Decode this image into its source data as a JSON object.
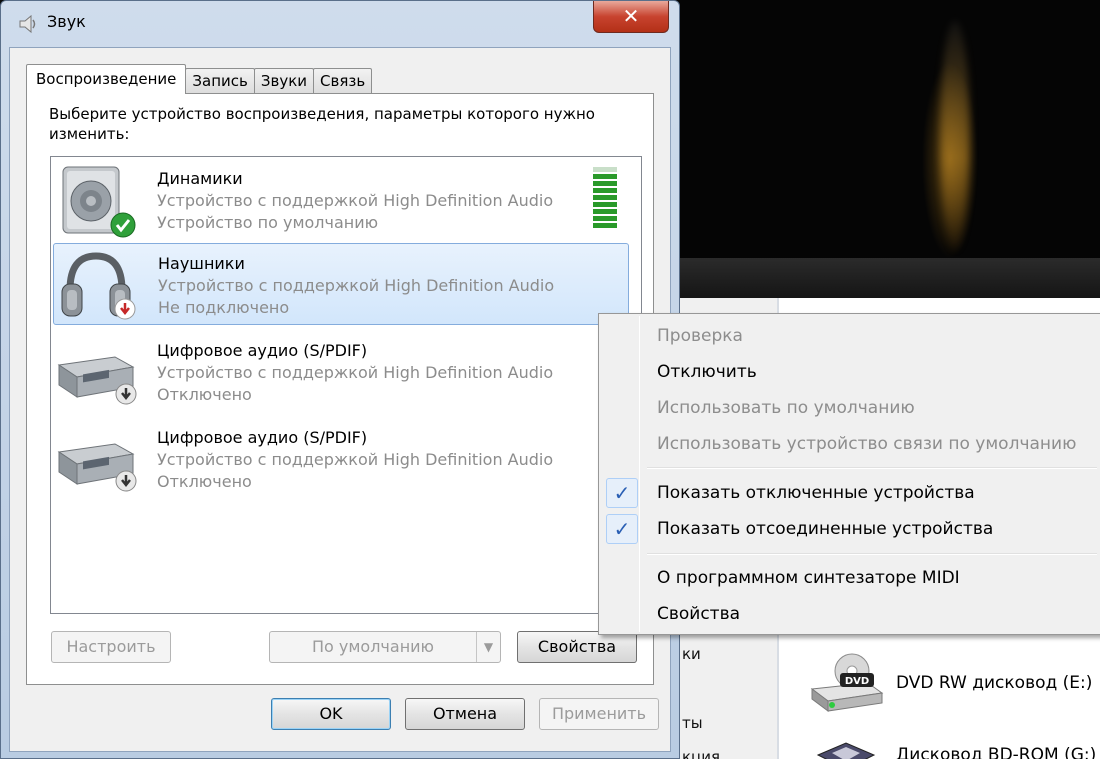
{
  "window": {
    "title": "Звук",
    "close_glyph": "✕"
  },
  "tabs": [
    {
      "label": "Воспроизведение"
    },
    {
      "label": "Запись"
    },
    {
      "label": "Звуки"
    },
    {
      "label": "Связь"
    }
  ],
  "instruction": "Выберите устройство воспроизведения, параметры которого нужно изменить:",
  "devices": [
    {
      "name": "Динамики",
      "description": "Устройство с поддержкой High Definition Audio",
      "status": "Устройство по умолчанию"
    },
    {
      "name": "Наушники",
      "description": "Устройство с поддержкой High Definition Audio",
      "status": "Не подключено"
    },
    {
      "name": "Цифровое аудио (S/PDIF)",
      "description": "Устройство с поддержкой High Definition Audio",
      "status": "Отключено"
    },
    {
      "name": "Цифровое аудио (S/PDIF)",
      "description": "Устройство с поддержкой High Definition Audio",
      "status": "Отключено"
    }
  ],
  "level_meter": {
    "level": 0.85
  },
  "buttons": {
    "configure": "Настроить",
    "set_default": "По умолчанию",
    "properties": "Свойства",
    "ok": "OK",
    "cancel": "Отмена",
    "apply": "Применить"
  },
  "context_menu": {
    "items": [
      {
        "label": "Проверка",
        "enabled": false,
        "checked": false
      },
      {
        "label": "Отключить",
        "enabled": true,
        "checked": false
      },
      {
        "label": "Использовать по умолчанию",
        "enabled": false,
        "checked": false
      },
      {
        "label": "Использовать устройство связи по умолчанию",
        "enabled": false,
        "checked": false
      },
      {
        "label": "Показать отключенные устройства",
        "enabled": true,
        "checked": true
      },
      {
        "label": "Показать отсоединенные устройства",
        "enabled": true,
        "checked": true
      },
      {
        "label": "О программном синтезаторе MIDI",
        "enabled": true,
        "checked": false
      },
      {
        "label": "Свойства",
        "enabled": true,
        "checked": false
      }
    ],
    "check_glyph": "✓"
  },
  "background": {
    "left_fragments": [
      "ки",
      "ты",
      "кция"
    ],
    "drives": [
      {
        "label": "DVD RW дисковод (E:)",
        "icon_text": "DVD"
      },
      {
        "label": "Дисковод BD-ROM (G:)"
      }
    ]
  }
}
